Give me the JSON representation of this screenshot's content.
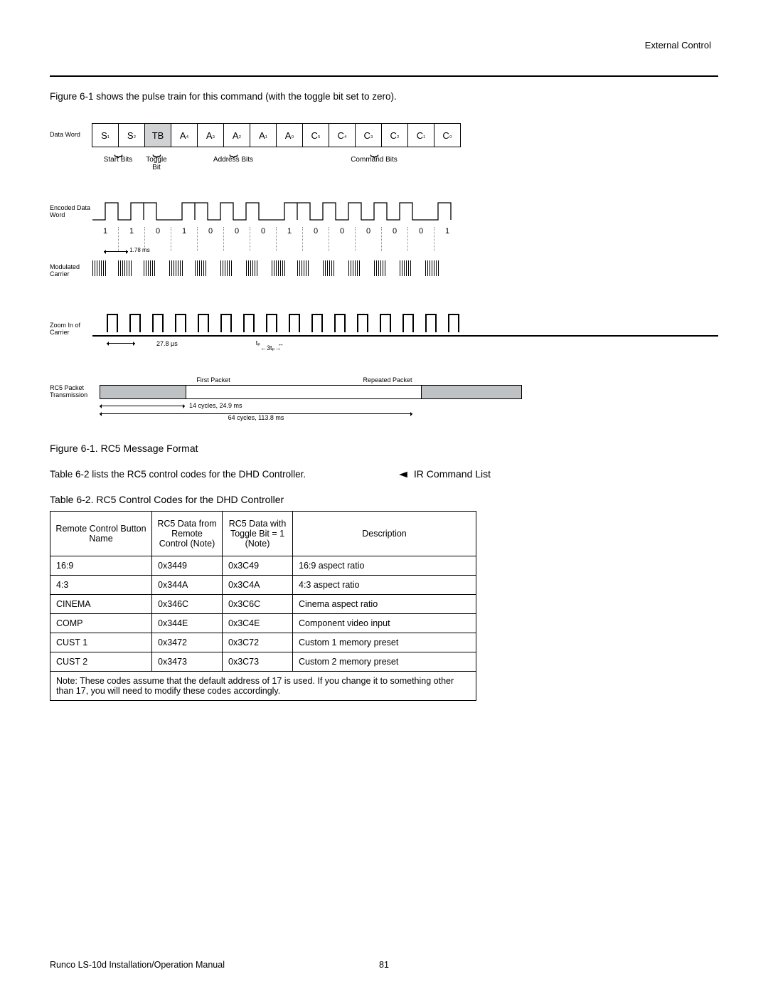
{
  "header": {
    "section": "External Control"
  },
  "intro": "Figure 6-1 shows the pulse train for this command (with the toggle bit set to zero).",
  "figure1": {
    "dataWordLabel": "Data Word",
    "bits": [
      "S₁",
      "S₂",
      "TB",
      "A₄",
      "A₃",
      "A₂",
      "A₁",
      "A₀",
      "C₅",
      "C₄",
      "C₃",
      "C₂",
      "C₁",
      "C₀"
    ],
    "groups": {
      "start": "Start Bits",
      "toggle": "Toggle Bit",
      "address": "Address Bits",
      "command": "Command Bits"
    },
    "encodedLabel": "Encoded Data Word",
    "encodedBits": [
      "1",
      "1",
      "0",
      "1",
      "0",
      "0",
      "0",
      "1",
      "0",
      "0",
      "0",
      "0",
      "0",
      "1"
    ],
    "bitPeriod": "1.78 ms",
    "modCarrierLabel": "Modulated Carrier",
    "zoomLabel": "Zoom In of Carrier",
    "zoomPeriod": "27.8 µs",
    "tp": "tₚ",
    "tp3": "3tₚ",
    "packetLabel": "RC5 Packet Transmission",
    "firstPacket": "First Packet",
    "repeatedPacket": "Repeated Packet",
    "cycles14": "14 cycles, 24.9 ms",
    "cycles64": "64 cycles,  113.8 ms",
    "caption": "Figure 6-1. RC5 Message Format"
  },
  "tableIntro": "Table 6-2 lists the RC5 control codes for the DHD Controller.",
  "irCommandList": "IR Command List",
  "tableTitle": "Table 6-2. RC5 Control Codes for the DHD Controller",
  "tableHeaders": {
    "button": "Remote Control Button Name",
    "code0": "RC5 Data from Remote Control (Note)",
    "code1": "RC5 Data with Toggle Bit = 1 (Note)",
    "desc": "Description"
  },
  "tableRows": [
    {
      "button": "16:9",
      "c0": "0x3449",
      "c1": "0x3C49",
      "desc": "16:9 aspect ratio"
    },
    {
      "button": "4:3",
      "c0": "0x344A",
      "c1": "0x3C4A",
      "desc": "4:3 aspect ratio"
    },
    {
      "button": "CINEMA",
      "c0": "0x346C",
      "c1": "0x3C6C",
      "desc": "Cinema aspect ratio"
    },
    {
      "button": "COMP",
      "c0": "0x344E",
      "c1": "0x3C4E",
      "desc": "Component video input"
    },
    {
      "button": "CUST 1",
      "c0": "0x3472",
      "c1": "0x3C72",
      "desc": "Custom 1 memory preset"
    },
    {
      "button": "CUST 2",
      "c0": "0x3473",
      "c1": "0x3C73",
      "desc": "Custom 2 memory preset"
    }
  ],
  "tableNote": "Note:  These codes assume that the default address of 17 is used. If you change it to something other than 17, you will need to modify these codes accordingly.",
  "footer": {
    "manual": "Runco LS-10d Installation/Operation Manual",
    "page": "81"
  },
  "chart_data": {
    "type": "table",
    "description": "RC5 message format timing diagram (not numeric chart)",
    "bit_sequence": [
      1,
      1,
      0,
      1,
      0,
      0,
      0,
      1,
      0,
      0,
      0,
      0,
      0,
      1
    ],
    "bit_labels": [
      "S1",
      "S2",
      "TB",
      "A4",
      "A3",
      "A2",
      "A1",
      "A0",
      "C5",
      "C4",
      "C3",
      "C2",
      "C1",
      "C0"
    ],
    "bit_period_ms": 1.78,
    "carrier_period_us": 27.8,
    "packet_cycles": 14,
    "packet_duration_ms": 24.9,
    "repeat_cycles": 64,
    "repeat_duration_ms": 113.8
  }
}
